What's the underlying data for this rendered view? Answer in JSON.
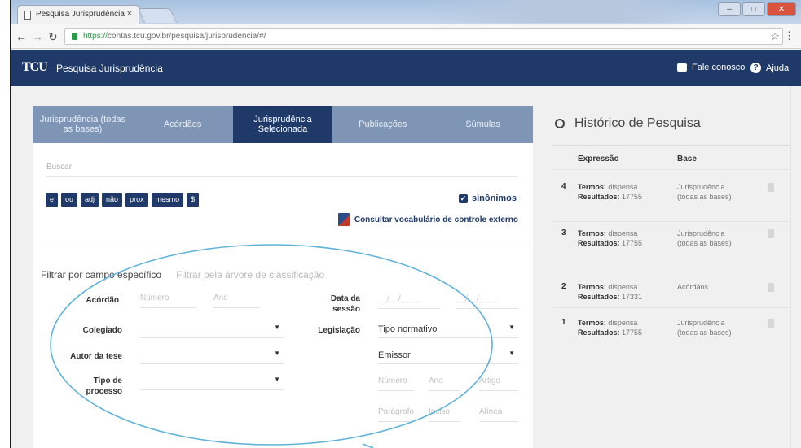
{
  "browser": {
    "tab_title": "Pesquisa Jurisprudência",
    "tab_close": "×",
    "url_https": "https://",
    "url_rest": "contas.tcu.gov.br/pesquisa/jurisprudencia/#/"
  },
  "header": {
    "logo": "TCU",
    "title": "Pesquisa Jurisprudência",
    "contact_label": "Fale conosco",
    "help_label": "Ajuda"
  },
  "tabs": [
    {
      "label": "Jurisprudência (todas as bases)"
    },
    {
      "label": "Acórdãos"
    },
    {
      "label": "Jurisprudência Selecionada"
    },
    {
      "label": "Publicações"
    },
    {
      "label": "Súmulas"
    }
  ],
  "search": {
    "placeholder": "Buscar",
    "operators": [
      "e",
      "ou",
      "adj",
      "não",
      "prox",
      "mesmo",
      "$"
    ],
    "synonyms_label": "sinônimos",
    "vocab_link": "Consultar vocabulário de controle externo"
  },
  "filters": {
    "by_field": "Filtrar por campo específico",
    "by_tree": "Filtrar pela árvore de classificação",
    "acordao_label": "Acórdão",
    "numero_ph": "Número",
    "ano_ph": "Ano",
    "data_sessao_label": "Data da sessão",
    "date_ph": "__/__/____",
    "colegiado_label": "Colegiado",
    "legislacao_label": "Legislação",
    "tipo_normativo": "Tipo normativo",
    "autor_tese_label": "Autor da tese",
    "emissor": "Emissor",
    "tipo_processo_label": "Tipo de processo",
    "numero2_ph": "Número",
    "ano2_ph": "Ano",
    "artigo_ph": "Artigo",
    "paragrafo_ph": "Parágrafo",
    "inciso_ph": "Inciso",
    "alinea_ph": "Alínea"
  },
  "history": {
    "title": "Histórico de Pesquisa",
    "col_expressao": "Expressão",
    "col_base": "Base",
    "rows": [
      {
        "n": "4",
        "termos_label": "Termos:",
        "termos": "dispensa",
        "resultados_label": "Resultados:",
        "resultados": "17755",
        "base": "Jurisprudência (todas as bases)"
      },
      {
        "n": "3",
        "termos_label": "Termos:",
        "termos": "dispensa",
        "resultados_label": "Resultados:",
        "resultados": "17755",
        "base": "Jurisprudência (todas as bases)"
      },
      {
        "n": "2",
        "termos_label": "Termos:",
        "termos": "dispensa",
        "resultados_label": "Resultados:",
        "resultados": "17331",
        "base": "Acórdãos"
      },
      {
        "n": "1",
        "termos_label": "Termos:",
        "termos": "dispensa",
        "resultados_label": "Resultados:",
        "resultados": "17755",
        "base": "Jurisprudência (todas as bases)"
      }
    ]
  },
  "colors": {
    "header_bg": "#1f3a68",
    "tab_bg": "#7f95b5",
    "annotation": "#5fb3d9"
  }
}
